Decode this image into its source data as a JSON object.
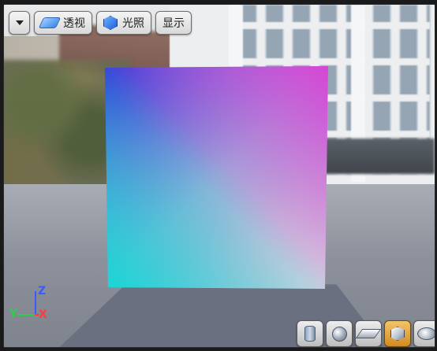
{
  "toolbar": {
    "menu_dropdown": "",
    "perspective_label": "透视",
    "lighting_label": "光照",
    "show_label": "显示"
  },
  "axis_gizmo": {
    "z": "Z",
    "y": "Y",
    "x": "X",
    "colors": {
      "z": "#3b5bff",
      "y": "#2bd04a",
      "x": "#ff3b3b"
    }
  },
  "preview_shapes": {
    "items": [
      {
        "name": "cylinder-icon"
      },
      {
        "name": "sphere-icon"
      },
      {
        "name": "plane-icon"
      },
      {
        "name": "cube-icon",
        "active": true
      },
      {
        "name": "teapot-icon"
      }
    ],
    "accent": "#d38a22"
  }
}
